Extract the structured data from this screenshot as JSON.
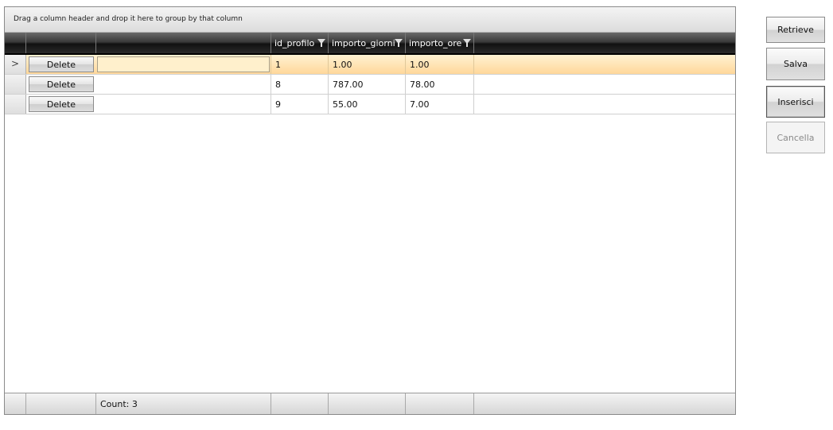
{
  "group_panel": {
    "text": "Drag a column header and drop it here to group by that column"
  },
  "columns": [
    "",
    "",
    "",
    "id_profilo",
    "importo_giorni",
    "importo_ore"
  ],
  "rows": [
    {
      "indicator": ">",
      "action": "Delete",
      "text": "",
      "id_profilo": "1",
      "importo_giorni": "1.00",
      "importo_ore": "1.00",
      "selected": true
    },
    {
      "indicator": "",
      "action": "Delete",
      "text": "",
      "id_profilo": "8",
      "importo_giorni": "787.00",
      "importo_ore": "78.00",
      "selected": false
    },
    {
      "indicator": "",
      "action": "Delete",
      "text": "",
      "id_profilo": "9",
      "importo_giorni": "55.00",
      "importo_ore": "7.00",
      "selected": false
    }
  ],
  "footer": {
    "count": "Count: 3"
  },
  "buttons": {
    "retrieve": "Retrieve",
    "salva": "Salva",
    "inserisci": "Inserisci",
    "cancella": "Cancella"
  }
}
